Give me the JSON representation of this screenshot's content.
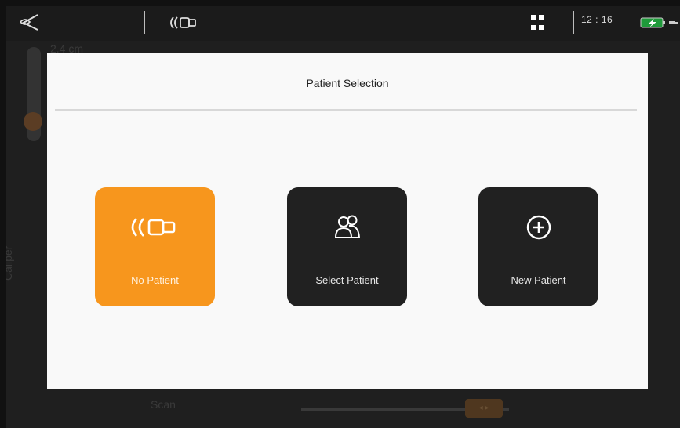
{
  "top_bar": {
    "time": "12 : 16",
    "icons": [
      "caliper-logo-icon",
      "probe-icon",
      "grid-icon",
      "battery-charging-icon"
    ]
  },
  "background": {
    "depth_label": "2.4 cm",
    "side_label": "Caliper",
    "bottom_label": "Scan"
  },
  "modal": {
    "title": "Patient Selection",
    "options": [
      {
        "label": "No Patient",
        "icon": "probe-icon",
        "color": "#f7961d"
      },
      {
        "label": "Select Patient",
        "icon": "people-icon",
        "color": "#212121"
      },
      {
        "label": "New Patient",
        "icon": "plus-circle-icon",
        "color": "#212121"
      }
    ]
  }
}
